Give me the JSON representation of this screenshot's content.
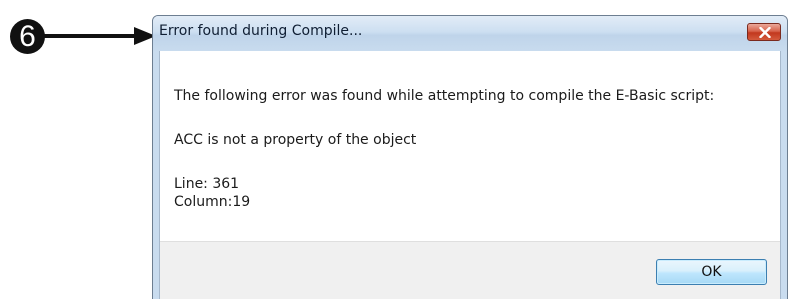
{
  "callout": {
    "number": "6"
  },
  "dialog": {
    "title": "Error found during Compile...",
    "message_intro": "The following error was found while attempting to compile the E-Basic script:",
    "error_text": "ACC is not a property of the object",
    "line_text": "Line: 361",
    "column_text": "Column:19",
    "ok_label": "OK",
    "close_icon": "close-x-icon"
  },
  "colors": {
    "close_button": "#c9442a",
    "ok_button_border": "#3c7fb1",
    "titlebar": "#c8dbee",
    "callout": "#111111"
  }
}
